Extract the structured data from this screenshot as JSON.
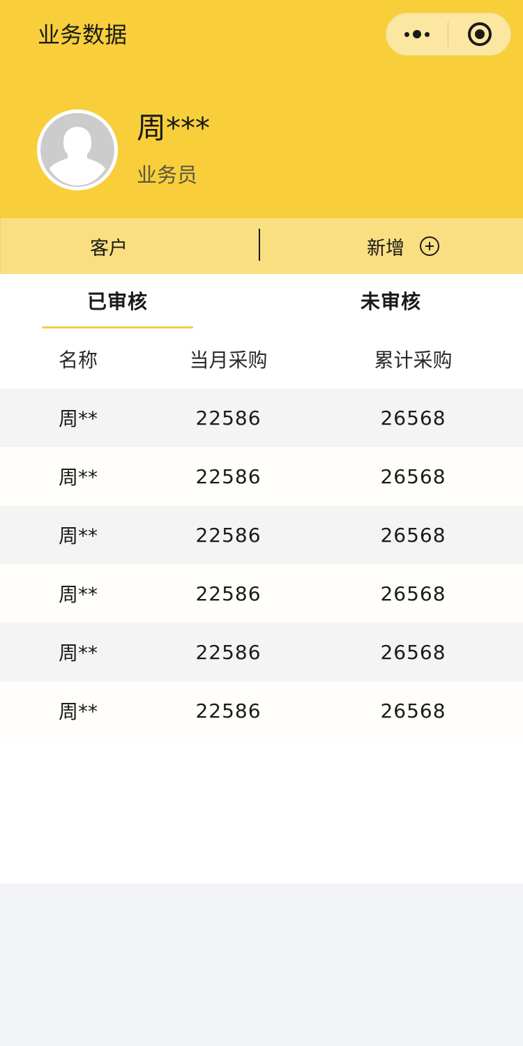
{
  "nav": {
    "title": "业务数据",
    "more_icon": "more-dots-icon",
    "close_icon": "target-close-icon"
  },
  "profile": {
    "name": "周***",
    "role": "业务员",
    "avatar_icon": "default-avatar-icon"
  },
  "actions": {
    "customers_label": "客户",
    "add_label": "新增",
    "add_icon": "plus-circle-icon"
  },
  "tabs": [
    {
      "label": "已审核",
      "active": true
    },
    {
      "label": "未审核",
      "active": false
    }
  ],
  "table": {
    "columns": [
      "名称",
      "当月采购",
      "累计采购"
    ],
    "rows": [
      {
        "name": "周**",
        "month": "22586",
        "total": "26568"
      },
      {
        "name": "周**",
        "month": "22586",
        "total": "26568"
      },
      {
        "name": "周**",
        "month": "22586",
        "total": "26568"
      },
      {
        "name": "周**",
        "month": "22586",
        "total": "26568"
      },
      {
        "name": "周**",
        "month": "22586",
        "total": "26568"
      },
      {
        "name": "周**",
        "month": "22586",
        "total": "26568"
      }
    ]
  },
  "colors": {
    "brand_yellow": "#f8cf3b",
    "bar_yellow": "#fadf82",
    "tab_underline": "#f4cd44"
  }
}
